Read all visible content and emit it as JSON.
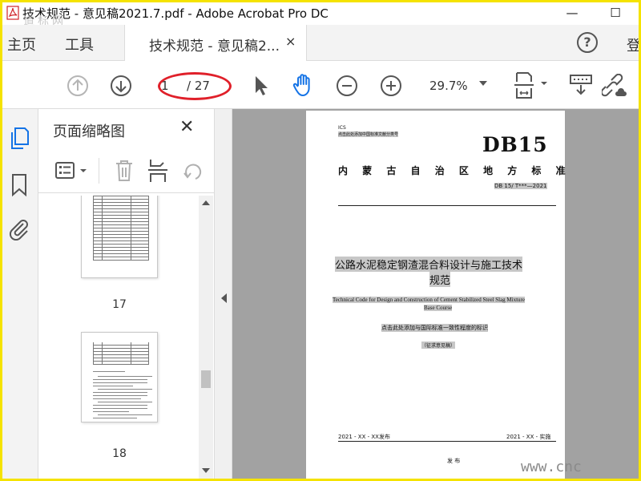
{
  "window": {
    "title": "技术规范 - 意见稿2021.7.pdf - Adobe Acrobat Pro DC",
    "watermark_tl": "道标网",
    "minimize": "—",
    "maximize": "☐"
  },
  "menubar": {
    "home": "主页",
    "tools": "工具",
    "tab_label": "技术规范 - 意见稿2...",
    "tab_close": "×",
    "help": "?",
    "login": "登"
  },
  "toolbar": {
    "page_current": "1",
    "page_total": "/ 27",
    "zoom": "29.7%",
    "annotation_color": "#e0202a",
    "hand_color": "#1473e6"
  },
  "panel": {
    "title": "页面缩略图",
    "close": "✕",
    "thumbnails": [
      {
        "label": "17"
      },
      {
        "label": "18"
      }
    ]
  },
  "document": {
    "ics": "ICS",
    "ics_note": "点击此处添加中国标准文献分类号",
    "db_code": "DB15",
    "region": "内 蒙 古 自 治 区 地 方 标 准",
    "number": "DB 15/ T***—2021",
    "title_cn_line1": "公路水泥稳定钢渣混合料设计与施工技术",
    "title_cn_line2": "规范",
    "title_en_line1": "Technical Code for Design and Construction of Cement Stabilized Steel Slag Mixture",
    "title_en_line2": "Base Course",
    "consistency": "点击此处添加与国际标准一致性程度的标识",
    "draft": "（征求意见稿）",
    "publish_date": "2021 - XX - XX发布",
    "impl_date": "2021 - XX -    实施",
    "publish": "发 布",
    "watermark_br": "www.cnc"
  }
}
